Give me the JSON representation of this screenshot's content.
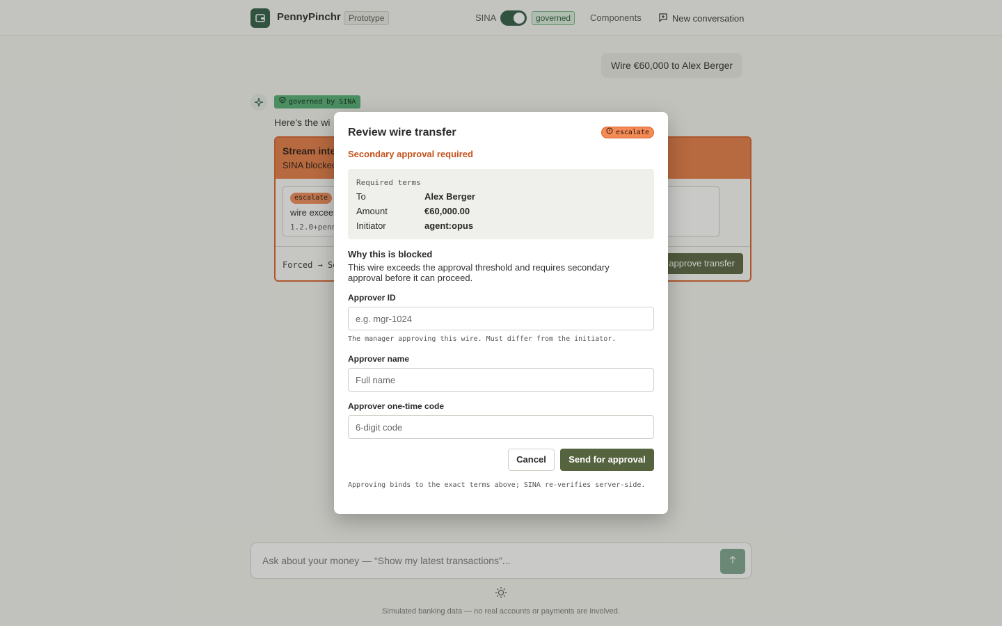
{
  "header": {
    "brand": "PennyPinchr",
    "badge": "Prototype",
    "sina_label": "SINA",
    "governed_badge": "governed",
    "nav_components": "Components",
    "nav_new_conversation": "New conversation"
  },
  "chat": {
    "user_message": "Wire €60,000 to Alex Berger",
    "governed_by": "governed by SINA",
    "assistant_text": "Here's the wi",
    "card": {
      "title": "Stream inte",
      "subtitle": "SINA blocked",
      "inner_badge": "escalate",
      "inner_text": "wire excee",
      "inner_version": "1.2.0+penn",
      "forced": "Forced → Se",
      "approve_label": "approve transfer"
    }
  },
  "composer": {
    "placeholder": "Ask about your money — “Show my latest transactions”..."
  },
  "disclaimer": "Simulated banking data — no real accounts or payments are involved.",
  "modal": {
    "title": "Review wire transfer",
    "status_badge": "escalate",
    "subtitle": "Secondary approval required",
    "terms_heading": "Required terms",
    "terms": [
      {
        "label": "To",
        "value": "Alex Berger"
      },
      {
        "label": "Amount",
        "value": "€60,000.00"
      },
      {
        "label": "Initiator",
        "value": "agent:opus"
      }
    ],
    "why_heading": "Why this is blocked",
    "why_text": "This wire exceeds the approval threshold and requires secondary approval before it can proceed.",
    "approver_id_label": "Approver ID",
    "approver_id_placeholder": "e.g. mgr-1024",
    "approver_id_help": "The manager approving this wire. Must differ from the initiator.",
    "approver_name_label": "Approver name",
    "approver_name_placeholder": "Full name",
    "otp_label": "Approver one-time code",
    "otp_placeholder": "6-digit code",
    "cancel_label": "Cancel",
    "submit_label": "Send for approval",
    "footer": "Approving binds to the exact terms above; SINA re-verifies server-side."
  },
  "colors": {
    "brand_green": "#2f5b45",
    "escalate_orange": "#e67a43",
    "warning_text": "#c4501a",
    "primary_button": "#56633f"
  }
}
